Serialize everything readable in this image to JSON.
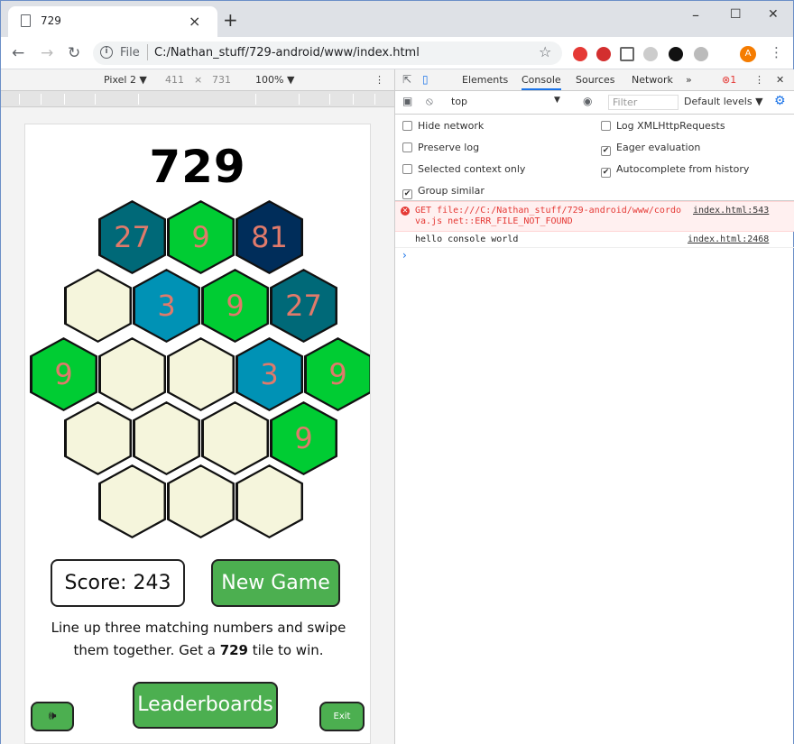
{
  "browser": {
    "tab_title": "729",
    "tab_close": "×",
    "new_tab": "+",
    "minimize": "–",
    "maximize": "☐",
    "close": "✕",
    "scheme": "File",
    "url": "C:/Nathan_stuff/729-android/www/index.html",
    "avatar_initial": "A"
  },
  "device_toolbar": {
    "device": "Pixel 2 ▼",
    "width": "411",
    "times": "×",
    "height": "731",
    "zoom": "100% ▼",
    "more": "⋮"
  },
  "game": {
    "title": "729",
    "tiles": [
      {
        "value": "27",
        "color": "#006978"
      },
      {
        "value": "9",
        "color": "#00cc33"
      },
      {
        "value": "81",
        "color": "#002d5a"
      },
      {
        "value": "",
        "color": ""
      },
      {
        "value": "3",
        "color": "#0092b5"
      },
      {
        "value": "9",
        "color": "#00cc33"
      },
      {
        "value": "27",
        "color": "#006978"
      },
      {
        "value": "9",
        "color": "#00cc33"
      },
      {
        "value": "",
        "color": ""
      },
      {
        "value": "",
        "color": ""
      },
      {
        "value": "3",
        "color": "#0092b5"
      },
      {
        "value": "9",
        "color": "#00cc33"
      },
      {
        "value": "",
        "color": ""
      },
      {
        "value": "",
        "color": ""
      },
      {
        "value": "",
        "color": ""
      },
      {
        "value": "9",
        "color": "#00cc33"
      },
      {
        "value": "",
        "color": ""
      },
      {
        "value": "",
        "color": ""
      },
      {
        "value": "",
        "color": ""
      }
    ],
    "score_label": "Score: 243",
    "new_game": "New Game",
    "instructions_a": "Line up three matching numbers and swipe them together. Get a ",
    "instructions_bold": "729",
    "instructions_b": " tile to win.",
    "leaderboards": "Leaderboards",
    "sound_icon": "🕪",
    "exit": "Exit"
  },
  "devtools": {
    "tabs": [
      "Elements",
      "Console",
      "Sources",
      "Network"
    ],
    "active_tab": "Console",
    "overflow": "»",
    "error_count": "1",
    "more": "⋮",
    "close": "✕",
    "context": "top",
    "filter_placeholder": "Filter",
    "levels": "Default levels ▼",
    "settings": [
      {
        "label": "Hide network",
        "checked": false
      },
      {
        "label": "Log XMLHttpRequests",
        "checked": false
      },
      {
        "label": "Preserve log",
        "checked": false
      },
      {
        "label": "Eager evaluation",
        "checked": true
      },
      {
        "label": "Selected context only",
        "checked": false
      },
      {
        "label": "Autocomplete from history",
        "checked": true
      },
      {
        "label": "Group similar",
        "checked": true
      }
    ],
    "error_line1": "GET file:///C:/Nathan_stuff/729-android/www/cordo",
    "error_line2": "va.js net::ERR_FILE_NOT_FOUND",
    "error_source": "index.html:543",
    "log_text": "hello console world",
    "log_source": "index.html:2468",
    "prompt": "›"
  },
  "colors": {
    "accent": "#1a73e8",
    "error": "#e53935",
    "button_green": "#4caf50",
    "empty_tile": "#f5f5dc",
    "tile_number": "#e07a6b"
  }
}
